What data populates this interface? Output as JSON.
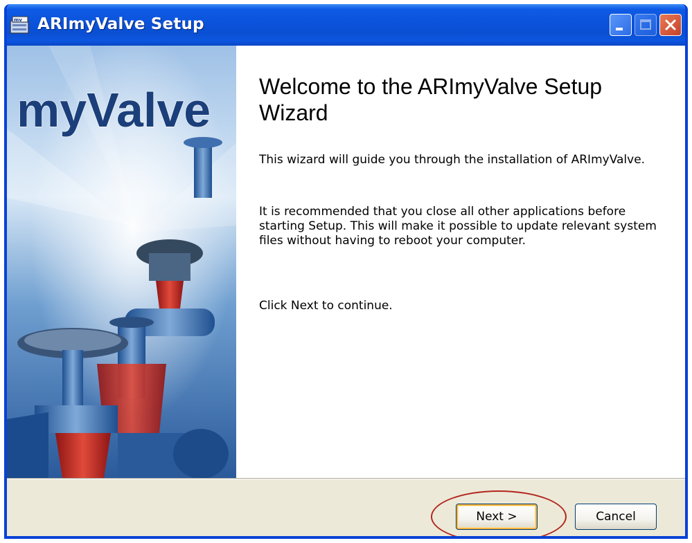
{
  "window": {
    "title": "ARImyValve Setup",
    "icon": "installer-app-icon",
    "controls": [
      "minimize-icon",
      "maximize-icon",
      "close-icon"
    ]
  },
  "sidebar": {
    "brand_text": "myValve",
    "image": "valve-illustration"
  },
  "content": {
    "heading": "Welcome to the ARImyValve Setup Wizard",
    "paragraphs": [
      "This wizard will guide you through the installation of ARImyValve.",
      "It is recommended that you close all other applications before starting Setup. This will make it possible to update relevant system files without having to reboot your computer.",
      "Click Next to continue."
    ]
  },
  "buttons": {
    "next_label": "Next >",
    "cancel_label": "Cancel"
  },
  "colors": {
    "titlebar": "#0a4fd3",
    "dialog_bg": "#ece9d8",
    "annotation": "#b3261e",
    "default_button_glow": "#f8b33f"
  }
}
